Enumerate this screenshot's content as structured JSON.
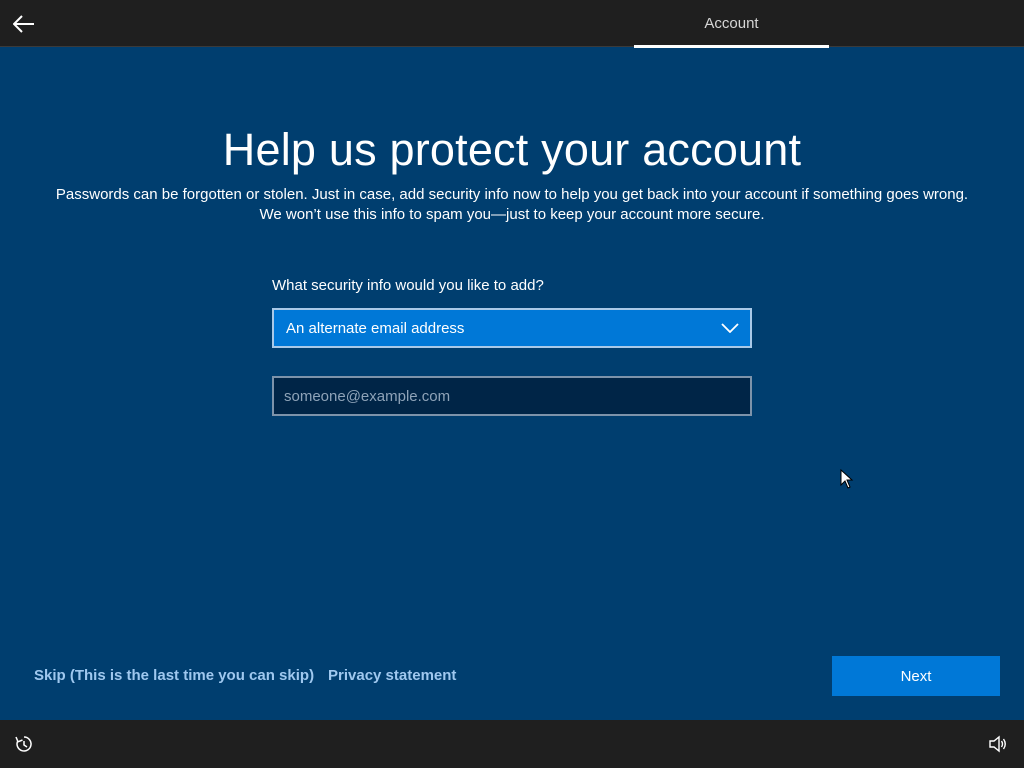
{
  "header": {
    "back_icon": "arrow-left-icon",
    "tab_label": "Account"
  },
  "main": {
    "title": "Help us protect your account",
    "description_line1": "Passwords can be forgotten or stolen. Just in case, add security info now to help you get back into your account if something goes wrong.",
    "description_line2": "We won’t use this info to spam you—just to keep your account more secure.",
    "question": "What security info would you like to add?",
    "dropdown": {
      "selected": "An alternate email address",
      "icon": "chevron-down-icon"
    },
    "email_input": {
      "value": "",
      "placeholder": "someone@example.com"
    }
  },
  "footer": {
    "skip_label": "Skip (This is the last time you can skip)",
    "privacy_label": "Privacy statement",
    "next_label": "Next"
  },
  "bottombar": {
    "left_icon": "ease-of-access-icon",
    "right_icon": "volume-icon"
  },
  "colors": {
    "background": "#003e6f",
    "bar": "#1f1f1f",
    "accent": "#0078d7",
    "link": "#9fc8ef"
  }
}
